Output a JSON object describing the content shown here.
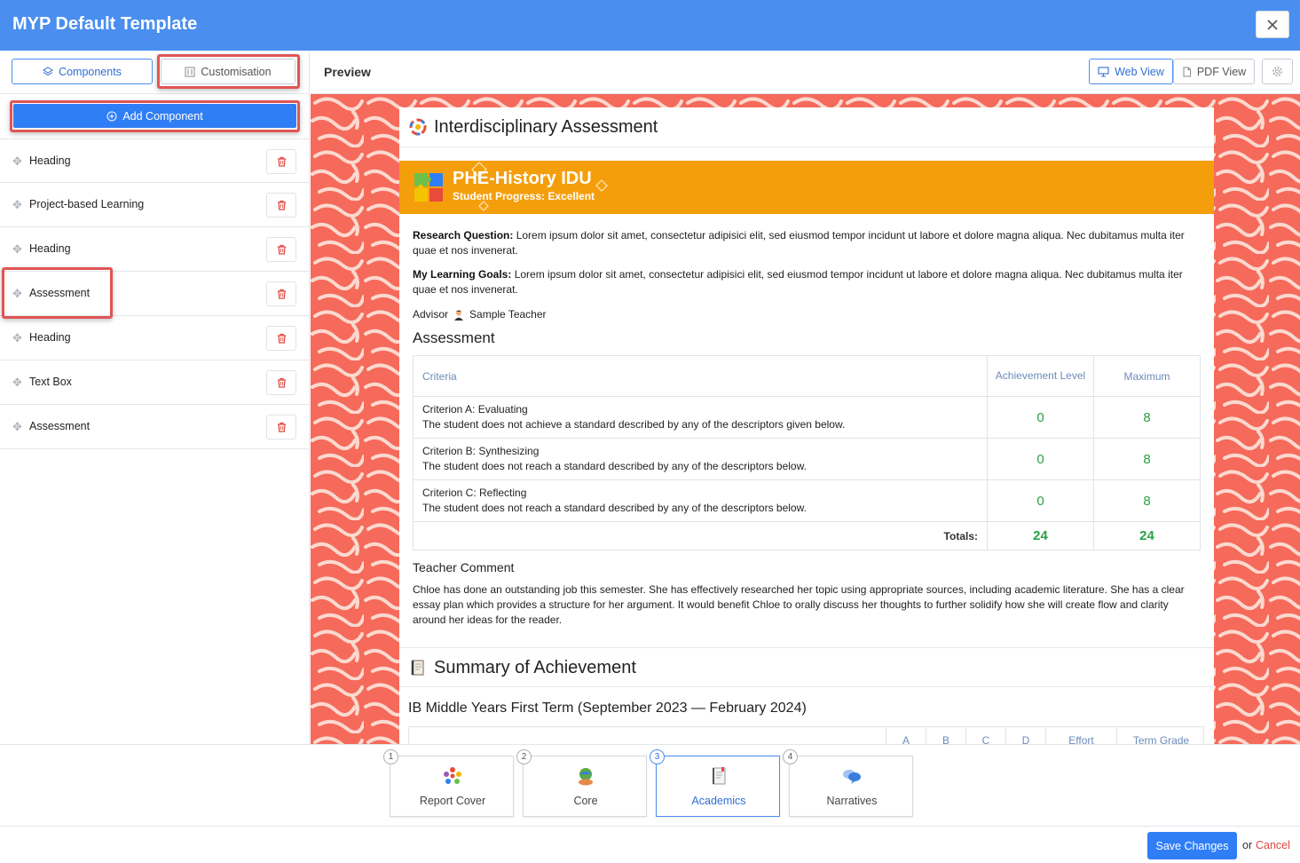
{
  "window": {
    "title": "MYP Default Template"
  },
  "sidebar": {
    "tabs": {
      "components": "Components",
      "customisation": "Customisation"
    },
    "add_component": "Add Component",
    "items": [
      {
        "label": "Heading"
      },
      {
        "label": "Project-based Learning"
      },
      {
        "label": "Heading"
      },
      {
        "label": "Assessment"
      },
      {
        "label": "Heading"
      },
      {
        "label": "Text Box"
      },
      {
        "label": "Assessment"
      }
    ]
  },
  "preview": {
    "title": "Preview",
    "web_view": "Web View",
    "pdf_view": "PDF View"
  },
  "document": {
    "section1_title": "Interdisciplinary Assessment",
    "banner": {
      "title": "PHE-History IDU",
      "subtitle": "Student Progress: Excellent"
    },
    "research_label": "Research Question:",
    "research_text": " Lorem ipsum dolor sit amet, consectetur adipisici elit, sed eiusmod tempor incidunt ut labore et dolore magna aliqua. Nec dubitamus multa iter quae et nos invenerat.",
    "goals_label": "My Learning Goals:",
    "goals_text": " Lorem ipsum dolor sit amet, consectetur adipisici elit, sed eiusmod tempor incidunt ut labore et dolore magna aliqua. Nec dubitamus multa iter quae et nos invenerat.",
    "advisor_label": "Advisor",
    "advisor_name": "Sample Teacher",
    "assessment_title": "Assessment",
    "table": {
      "headers": {
        "criteria": "Criteria",
        "achievement": "Achievement Level",
        "maximum": "Maximum"
      },
      "rows": [
        {
          "name": "Criterion A: Evaluating",
          "desc": "The student does not achieve a standard described by any of the descriptors given below.",
          "level": "0",
          "max": "8"
        },
        {
          "name": "Criterion B: Synthesizing",
          "desc": "The student does not reach a standard described by any of the descriptors below.",
          "level": "0",
          "max": "8"
        },
        {
          "name": "Criterion C: Reflecting",
          "desc": "The student does not reach a standard described by any of the descriptors below.",
          "level": "0",
          "max": "8"
        }
      ],
      "totals_label": "Totals:",
      "total_level": "24",
      "total_max": "24"
    },
    "teacher_comment_title": "Teacher Comment",
    "teacher_comment": "Chloe has done an outstanding job this semester. She has effectively researched her topic using appropriate sources, including academic literature. She has a clear essay plan which provides a structure for her argument. It would benefit Chloe to orally discuss her thoughts to further solidify how she will create flow and clarity around her ideas for the reader.",
    "section2_title": "Summary of Achievement",
    "summary_subtitle": "IB Middle Years First Term (September 2023 — February 2024)",
    "summary_columns": [
      "A",
      "B",
      "C",
      "D",
      "Effort",
      "Term Grade"
    ]
  },
  "stepper": [
    {
      "num": "1",
      "label": "Report Cover"
    },
    {
      "num": "2",
      "label": "Core"
    },
    {
      "num": "3",
      "label": "Academics"
    },
    {
      "num": "4",
      "label": "Narratives"
    }
  ],
  "footer": {
    "save": "Save Changes",
    "or": "or",
    "cancel": "Cancel"
  },
  "colors": {
    "header": "#4a8ef0",
    "primary": "#2f7ef5",
    "banner": "#f59e0b",
    "background_pattern": "#f56a5b",
    "success": "#2aa146",
    "danger": "#e0483e"
  }
}
